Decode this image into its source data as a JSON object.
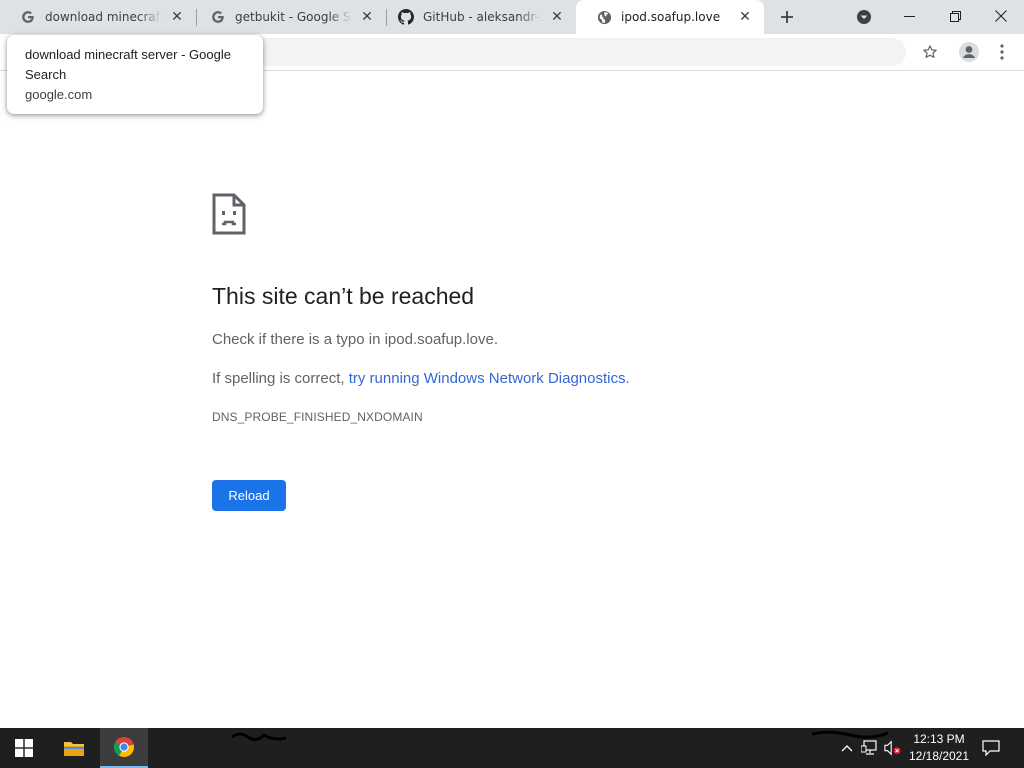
{
  "tabs": [
    {
      "title": "download minecraft server - Google Search",
      "favicon": "google-g-icon"
    },
    {
      "title": "getbukit - Google Search",
      "favicon": "google-g-icon"
    },
    {
      "title": "GitHub - aleksandr-sosnovskii",
      "favicon": "github-icon"
    },
    {
      "title": "ipod.soafup.love",
      "favicon": "globe-icon",
      "active": true
    }
  ],
  "hover_card": {
    "title": "download minecraft server - Google Search",
    "domain": "google.com"
  },
  "error_page": {
    "heading": "This site can’t be reached",
    "typo_text": "Check if there is a typo in ipod.soafup.love.",
    "spelling_prefix": "If spelling is correct, ",
    "diagnostics_link": "try running Windows Network Diagnostics",
    "spelling_suffix": ".",
    "error_code": "DNS_PROBE_FINISHED_NXDOMAIN",
    "reload_label": "Reload"
  },
  "taskbar": {
    "time": "12:13 PM",
    "date": "12/18/2021"
  },
  "colors": {
    "accent": "#1a73e8",
    "link": "#3367d6",
    "tabstrip": "#dee1e6",
    "taskbar": "#1f1f1f"
  }
}
